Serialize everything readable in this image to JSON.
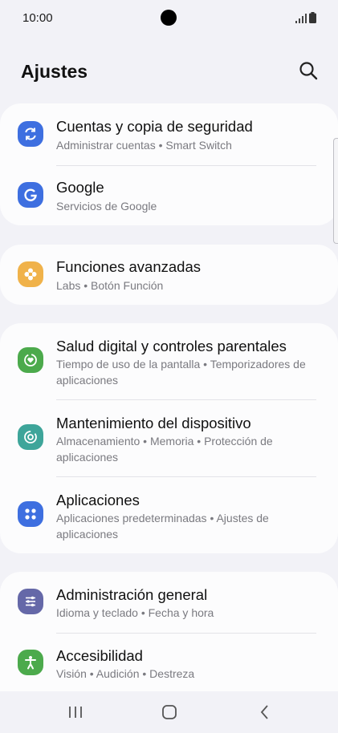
{
  "status": {
    "time": "10:00"
  },
  "header": {
    "title": "Ajustes"
  },
  "items": [
    {
      "title": "Cuentas y copia de seguridad",
      "subtitle": "Administrar cuentas  •  Smart Switch",
      "icon": "sync-icon",
      "color": "#3e6fe0"
    },
    {
      "title": "Google",
      "subtitle": "Servicios de Google",
      "icon": "google-icon",
      "color": "#3e6fe0"
    },
    {
      "title": "Funciones avanzadas",
      "subtitle": "Labs  •  Botón Función",
      "icon": "puzzle-gear-icon",
      "color": "#f0b24a"
    },
    {
      "title": "Salud digital y controles parentales",
      "subtitle": "Tiempo de uso de la pantalla  •  Temporizadores de aplicaciones",
      "icon": "heart-circle-icon",
      "color": "#4caa4c"
    },
    {
      "title": "Mantenimiento del dispositivo",
      "subtitle": "Almacenamiento  •  Memoria  •  Protección de aplicaciones",
      "icon": "care-icon",
      "color": "#3ea59a"
    },
    {
      "title": "Aplicaciones",
      "subtitle": "Aplicaciones predeterminadas  •  Ajustes de aplicaciones",
      "icon": "apps-grid-icon",
      "color": "#3e6fe0"
    },
    {
      "title": "Administración general",
      "subtitle": "Idioma y teclado  •  Fecha y hora",
      "icon": "sliders-icon",
      "color": "#6568a8"
    },
    {
      "title": "Accesibilidad",
      "subtitle": "Visión  •  Audición  •  Destreza",
      "icon": "accessibility-icon",
      "color": "#4caa4c"
    }
  ]
}
